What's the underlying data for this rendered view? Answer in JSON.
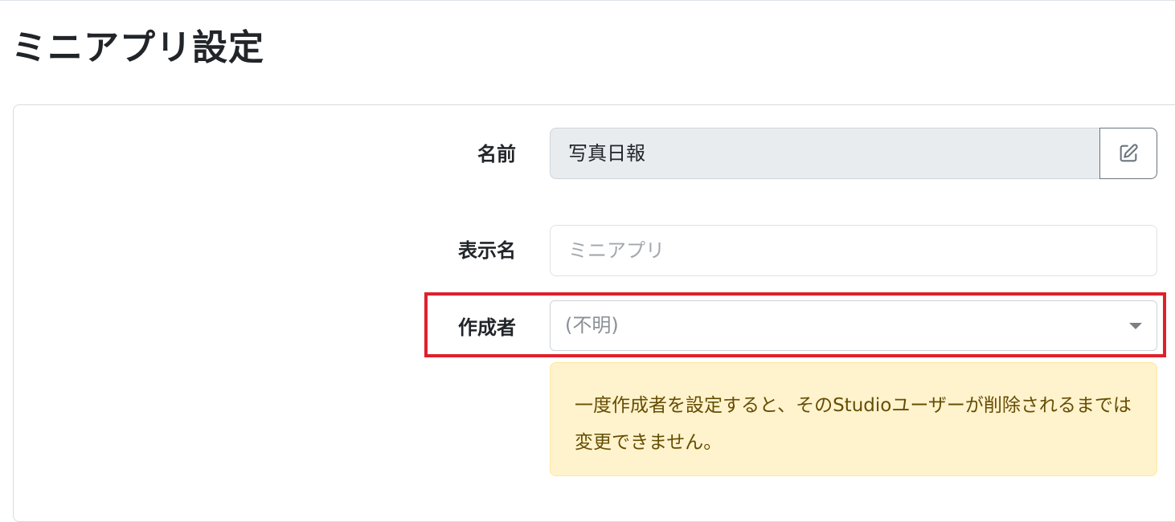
{
  "page": {
    "title": "ミニアプリ設定"
  },
  "form": {
    "name": {
      "label": "名前",
      "value": "写真日報",
      "edit_icon": "edit-square-icon"
    },
    "display_name": {
      "label": "表示名",
      "placeholder": "ミニアプリ",
      "value": ""
    },
    "creator": {
      "label": "作成者",
      "selected": "(不明)",
      "caret_icon": "caret-down-icon"
    },
    "creator_notice": "一度作成者を設定すると、そのStudioユーザーが削除されるまでは変更できません。"
  },
  "annotation": {
    "highlight_color": "#e0202b"
  },
  "colors": {
    "alert_bg": "#fff3cd",
    "alert_text": "#664d03",
    "readonly_bg": "#e9ecef"
  }
}
